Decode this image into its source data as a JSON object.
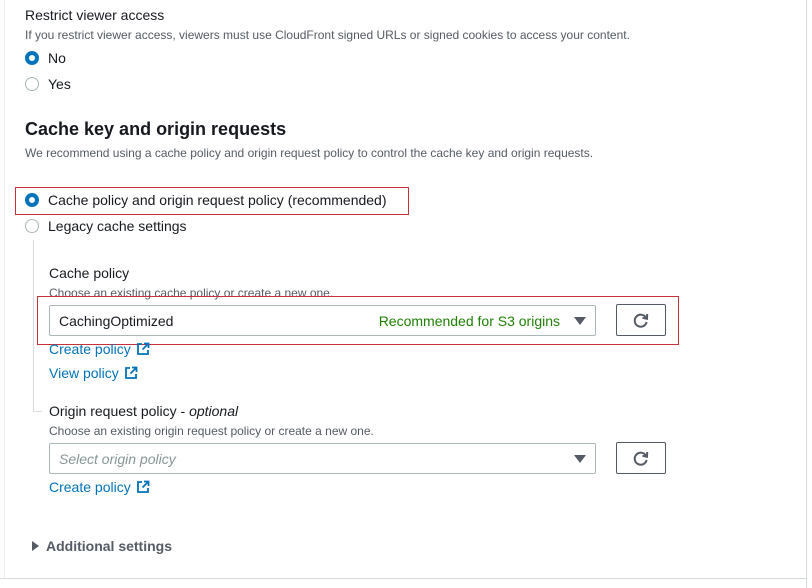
{
  "viewer_access": {
    "label": "Restrict viewer access",
    "description": "If you restrict viewer access, viewers must use CloudFront signed URLs or signed cookies to access your content.",
    "options": [
      {
        "label": "No",
        "selected": true
      },
      {
        "label": "Yes",
        "selected": false
      }
    ]
  },
  "cache_section": {
    "title": "Cache key and origin requests",
    "description": "We recommend using a cache policy and origin request policy to control the cache key and origin requests.",
    "options": [
      {
        "label": "Cache policy and origin request policy (recommended)",
        "selected": true
      },
      {
        "label": "Legacy cache settings",
        "selected": false
      }
    ]
  },
  "cache_policy": {
    "label": "Cache policy",
    "description": "Choose an existing cache policy or create a new one.",
    "selected_value": "CachingOptimized",
    "selected_tag": "Recommended for S3 origins",
    "create_link": "Create policy",
    "view_link": "View policy"
  },
  "origin_request_policy": {
    "label": "Origin request policy",
    "label_suffix": "optional",
    "description": "Choose an existing origin request policy or create a new one.",
    "placeholder": "Select origin policy",
    "create_link": "Create policy"
  },
  "additional_settings": {
    "label": "Additional settings"
  },
  "colors": {
    "accent": "#0073bb",
    "recommended": "#1d8102",
    "highlight": "#c7313b"
  }
}
